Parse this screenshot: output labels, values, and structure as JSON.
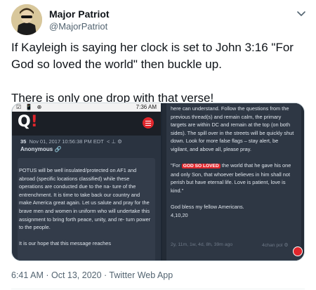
{
  "author": {
    "name": "Major Patriot",
    "handle": "@MajorPatriot"
  },
  "tweet": {
    "paragraph_1": "If Kayleigh is saying her clock is set to John 3:16 \"For God so loved the world\" then buckle up.",
    "paragraph_2": "There is only one drop with that verse!",
    "timestamp": "6:41 AM · Oct 13, 2020 · Twitter Web App"
  },
  "media_left": {
    "status_time": "7:36 AM",
    "status_icons_left": "☑ 📱 ⊕",
    "logo_letter": "Q",
    "logo_bang": "!",
    "post_number": "35",
    "post_date": "Nov 01, 2017 10:56:38 PM EDT",
    "post_actions": "< ⊥ ⚙",
    "author": "Anonymous",
    "link_icon": "🔗",
    "body_1": "POTUS will be well insulated/protected on AF1 and abroad (specific locations classified) while these operations are conducted due to the na- ture of the entrenchment. It is time to take back our country and make America great again. Let us salute and pray for the brave men and women in uniform who will undertake this assignment to bring forth peace, unity, and re- turn power to the people.",
    "body_2": "It is our hope that this message reaches"
  },
  "media_right": {
    "body_1": "here can understand. Follow the questions from the previous thread(s) and remain calm, the primary targets are within DC and remain at the top (on both sides). The spill over in the streets will be quickly shut down. Look for more false flags – stay alert, be vigilant, and above all, please pray.",
    "verse_open": "\"For",
    "verse_highlight": "GOD SO LOVED",
    "verse_rest": "the world that he gave his one and only Son, that whoever believes in him shall not perish but have eternal life. Love is patient, love is kind.\"",
    "blessing": "God bless my fellow Americans.",
    "sign_off": "4,10,20",
    "footer_age": "2y, 11m, 1w, 4d, 8h, 39m ago",
    "footer_board": "4chan pol",
    "footer_gear": "⚙"
  },
  "colors": {
    "accent_red": "#e0262c",
    "card_dark": "#2e3744",
    "handle_gray": "#536471"
  }
}
